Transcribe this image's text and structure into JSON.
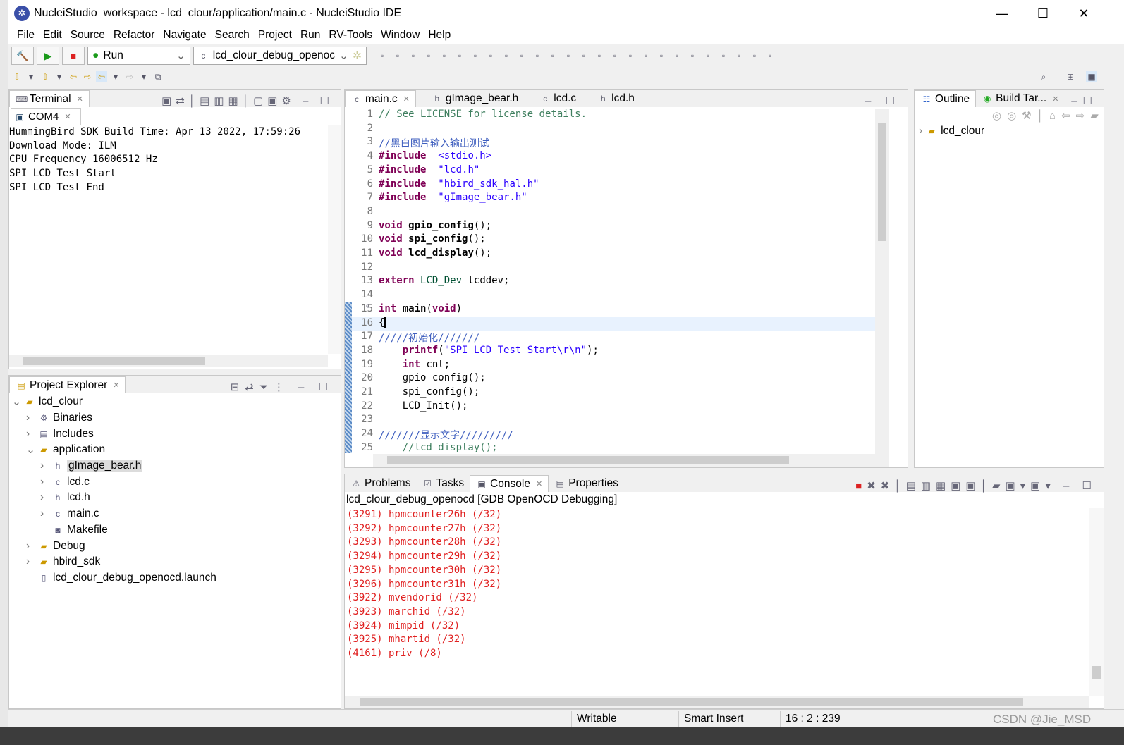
{
  "window": {
    "title": "NucleiStudio_workspace - lcd_clour/application/main.c - NucleiStudio IDE",
    "minimize": "—",
    "maximize": "☐",
    "close": "✕"
  },
  "menu": [
    "File",
    "Edit",
    "Source",
    "Refactor",
    "Navigate",
    "Search",
    "Project",
    "Run",
    "RV-Tools",
    "Window",
    "Help"
  ],
  "toolbar": {
    "mode": "Run",
    "launch_config": "lcd_clour_debug_openoc"
  },
  "terminal": {
    "tab": "Terminal",
    "subtab": "COM4",
    "lines": [
      "HummingBird SDK Build Time: Apr 13 2022, 17:59:26",
      "Download Mode: ILM",
      "CPU Frequency 16006512 Hz",
      "SPI LCD Test Start",
      "SPI LCD Test End"
    ]
  },
  "project_explorer": {
    "tab": "Project Explorer",
    "items": [
      {
        "label": "lcd_clour",
        "depth": 0,
        "arrow": "⌄",
        "icon": "project-folder-icon"
      },
      {
        "label": "Binaries",
        "depth": 1,
        "arrow": "›",
        "icon": "binaries-icon"
      },
      {
        "label": "Includes",
        "depth": 1,
        "arrow": "›",
        "icon": "includes-icon"
      },
      {
        "label": "application",
        "depth": 1,
        "arrow": "⌄",
        "icon": "folder-icon"
      },
      {
        "label": "gImage_bear.h",
        "depth": 2,
        "arrow": "›",
        "icon": "h-file-icon",
        "selected": true
      },
      {
        "label": "lcd.c",
        "depth": 2,
        "arrow": "›",
        "icon": "c-file-icon"
      },
      {
        "label": "lcd.h",
        "depth": 2,
        "arrow": "›",
        "icon": "h-file-icon"
      },
      {
        "label": "main.c",
        "depth": 2,
        "arrow": "›",
        "icon": "c-file-icon"
      },
      {
        "label": "Makefile",
        "depth": 2,
        "arrow": "",
        "icon": "makefile-icon"
      },
      {
        "label": "Debug",
        "depth": 1,
        "arrow": "›",
        "icon": "folder-icon"
      },
      {
        "label": "hbird_sdk",
        "depth": 1,
        "arrow": "›",
        "icon": "folder-icon"
      },
      {
        "label": "lcd_clour_debug_openocd.launch",
        "depth": 1,
        "arrow": "",
        "icon": "launch-file-icon"
      }
    ]
  },
  "editor": {
    "tabs": [
      "main.c",
      "gImage_bear.h",
      "lcd.c",
      "lcd.h"
    ],
    "active_tab": "main.c",
    "current_line": 16,
    "lines": [
      [
        [
          "cm",
          "// See LICENSE for license details."
        ]
      ],
      [],
      [
        [
          "cmb",
          "//黑白图片输入输出测试"
        ]
      ],
      [
        [
          "kw",
          "#include"
        ],
        [
          "",
          "  "
        ],
        [
          "str",
          "<stdio.h>"
        ]
      ],
      [
        [
          "kw",
          "#include"
        ],
        [
          "",
          "  "
        ],
        [
          "str",
          "\"lcd.h\""
        ]
      ],
      [
        [
          "kw",
          "#include"
        ],
        [
          "",
          "  "
        ],
        [
          "str",
          "\"hbird_sdk_hal.h\""
        ]
      ],
      [
        [
          "kw",
          "#include"
        ],
        [
          "",
          "  "
        ],
        [
          "str",
          "\"gImage_bear.h\""
        ]
      ],
      [],
      [
        [
          "kw",
          "void"
        ],
        [
          "",
          " "
        ],
        [
          "fn",
          "gpio_config"
        ],
        [
          "",
          "();"
        ]
      ],
      [
        [
          "kw",
          "void"
        ],
        [
          "",
          " "
        ],
        [
          "fn",
          "spi_config"
        ],
        [
          "",
          "();"
        ]
      ],
      [
        [
          "kw",
          "void"
        ],
        [
          "",
          " "
        ],
        [
          "fn",
          "lcd_display"
        ],
        [
          "",
          "();"
        ]
      ],
      [],
      [
        [
          "kw",
          "extern"
        ],
        [
          "",
          " "
        ],
        [
          "ty",
          "LCD_Dev"
        ],
        [
          "",
          " lcddev;"
        ]
      ],
      [],
      [
        [
          "kw",
          "int"
        ],
        [
          "",
          " "
        ],
        [
          "fn",
          "main"
        ],
        [
          "",
          "("
        ],
        [
          "kw",
          "void"
        ],
        [
          "",
          ")"
        ]
      ],
      [
        [
          "",
          "{"
        ]
      ],
      [
        [
          "cmb",
          "/////初始化///////"
        ]
      ],
      [
        [
          "",
          "    "
        ],
        [
          "kw",
          "printf"
        ],
        [
          "",
          "("
        ],
        [
          "str",
          "\"SPI LCD Test Start\\r\\n\""
        ],
        [
          "",
          ");"
        ]
      ],
      [
        [
          "",
          "    "
        ],
        [
          "kw",
          "int"
        ],
        [
          "",
          " cnt;"
        ]
      ],
      [
        [
          "",
          "    gpio_config();"
        ]
      ],
      [
        [
          "",
          "    spi_config();"
        ]
      ],
      [
        [
          "",
          "    LCD_Init();"
        ]
      ],
      [],
      [
        [
          "cmb",
          "///////显示文字/////////"
        ]
      ],
      [
        [
          "cm",
          "    //lcd_display();"
        ]
      ]
    ]
  },
  "outline": {
    "tabs": [
      "Outline",
      "Build Tar..."
    ],
    "items": [
      "lcd_clour"
    ]
  },
  "console": {
    "tabs": [
      "Problems",
      "Tasks",
      "Console",
      "Properties"
    ],
    "active_tab": "Console",
    "title": "lcd_clour_debug_openocd [GDB OpenOCD Debugging]",
    "lines": [
      "(3291) hpmcounter26h (/32)",
      "(3292) hpmcounter27h (/32)",
      "(3293) hpmcounter28h (/32)",
      "(3294) hpmcounter29h (/32)",
      "(3295) hpmcounter30h (/32)",
      "(3296) hpmcounter31h (/32)",
      "(3922) mvendorid (/32)",
      "(3923) marchid (/32)",
      "(3924) mimpid (/32)",
      "(3925) mhartid (/32)",
      "(4161) priv (/8)"
    ],
    "text_color": "#e02020"
  },
  "status": {
    "writable": "Writable",
    "insert_mode": "Smart Insert",
    "position": "16 : 2 : 239"
  },
  "watermark": "CSDN @Jie_MSD"
}
